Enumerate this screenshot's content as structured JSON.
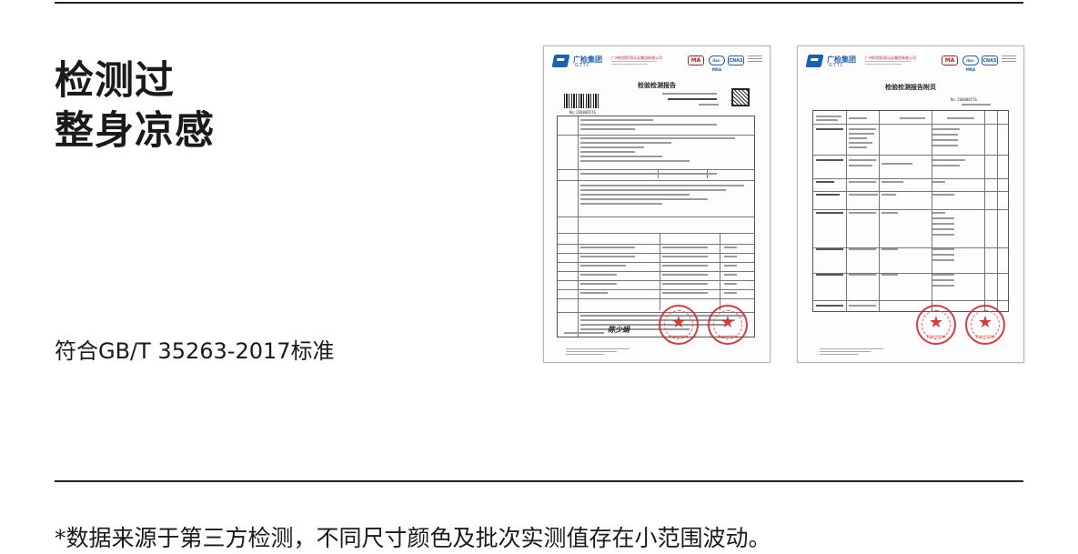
{
  "headline": {
    "line1": "检测过",
    "line2": "整身凉感"
  },
  "standard": "符合GB/T 35263-2017标准",
  "footnote": "*数据来源于第三方检测，不同尺寸颜色及批次实测值存在小范围波动。",
  "report_left": {
    "title": "检验检测报告",
    "report_no": "No:269008576",
    "logo_name": "广检集团",
    "logo_en": "GTTC",
    "org": "广州检验检测认证集团有限公司",
    "badges": [
      "MA",
      "ilac-MRA",
      "CNAS"
    ],
    "signature": "陈少娟",
    "seal_text": "检验检测专用章"
  },
  "report_right": {
    "title": "检验检测报告附页",
    "report_no": "No:269008576",
    "logo_name": "广检集团",
    "logo_en": "GTTC",
    "org": "广州检验检测认证集团有限公司",
    "badges": [
      "MA",
      "ilac-MRA",
      "CNAS"
    ],
    "seal_text": "检验检测专用章"
  },
  "colors": {
    "text": "#1a1a1a",
    "rule": "#222222",
    "brand_blue": "#1d5fb0",
    "seal_red": "#d6262a"
  }
}
